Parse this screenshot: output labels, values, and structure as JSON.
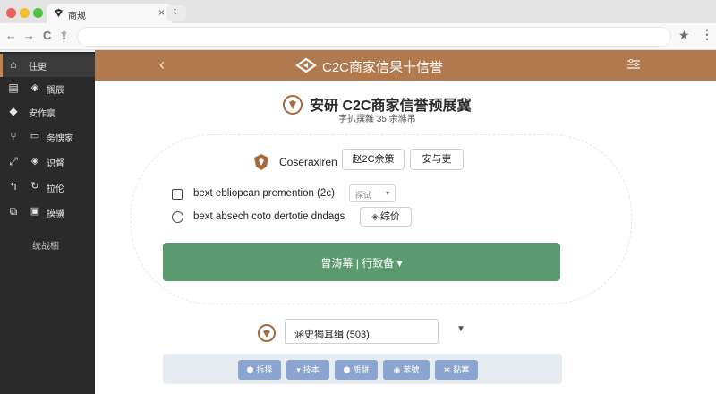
{
  "browser": {
    "tab_title": "商规",
    "tab_close": "×",
    "new_tab": "t",
    "back": "←",
    "forward": "→",
    "reload": "C",
    "share": "⇪",
    "star": "★",
    "menu": "⋮"
  },
  "sidebar": {
    "items": [
      {
        "label": "住更",
        "icon": "home-icon"
      },
      {
        "label": "搁辰",
        "icon": "document-icon"
      },
      {
        "label": "安作禀",
        "icon": "tag-icon"
      },
      {
        "label": "务馊家",
        "icon": "monitor-icon"
      },
      {
        "label": "识督",
        "icon": "logo-icon"
      },
      {
        "label": "拉伦",
        "icon": "refresh-icon"
      },
      {
        "label": "摸骥",
        "icon": "camera-icon"
      }
    ],
    "footer": "统战梱"
  },
  "header": {
    "title": "C2C商家信果十信誉"
  },
  "main": {
    "title": "安研 C2C商家信誉预展冀",
    "subtitle": "字扒撰雜 35 余滌吊",
    "row1_label": "Coseraxiren",
    "row1_btn_a": "赵2C余策",
    "row1_btn_b": "安与吏",
    "row2_label": "bext ebliopcan premention (2c)",
    "row2_select": "探试",
    "row3_label": "bext absech coto dertotie dndags",
    "row3_btn": "综价",
    "primary_label": "曾涛幕 | 行致备 ▾",
    "bottom_input": "涵史獨耳缉 (503)",
    "chips": [
      {
        "label": "拆择",
        "icon": "pin-icon"
      },
      {
        "label": "技本",
        "icon": "chevron-icon"
      },
      {
        "label": "质駢",
        "icon": "pin-icon"
      },
      {
        "label": "苯號",
        "icon": "eye-icon"
      },
      {
        "label": "黏塞",
        "icon": "gear-icon"
      }
    ]
  },
  "colors": {
    "header": "#b07a4e",
    "primary": "#5b9a6f",
    "sidebar": "#2a2a2a",
    "chip": "#8aa5cf"
  }
}
